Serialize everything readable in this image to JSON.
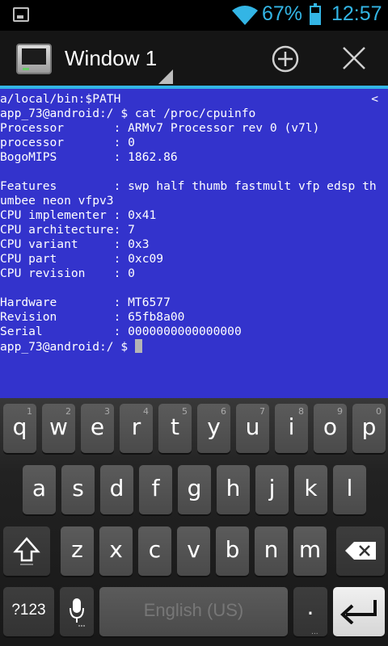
{
  "status_bar": {
    "battery_percent": "67%",
    "battery_level": 0.67,
    "time": "12:57",
    "accent_color": "#33b5e5"
  },
  "action_bar": {
    "title": "Window 1",
    "add_icon": "plus-circle-icon",
    "close_icon": "close-icon"
  },
  "terminal": {
    "background": "#3333cc",
    "overflow_marker": "<",
    "lines": [
      "a/local/bin:$PATH",
      "app_73@android:/ $ cat /proc/cpuinfo",
      "Processor       : ARMv7 Processor rev 0 (v7l)",
      "processor       : 0",
      "BogoMIPS        : 1862.86",
      "",
      "Features        : swp half thumb fastmult vfp edsp th",
      "umbee neon vfpv3",
      "CPU implementer : 0x41",
      "CPU architecture: 7",
      "CPU variant     : 0x3",
      "CPU part        : 0xc09",
      "CPU revision    : 0",
      "",
      "Hardware        : MT6577",
      "Revision        : 65fb8a00",
      "Serial          : 0000000000000000",
      "app_73@android:/ $ "
    ]
  },
  "keyboard": {
    "row1": [
      {
        "label": "q",
        "hint": "1"
      },
      {
        "label": "w",
        "hint": "2"
      },
      {
        "label": "e",
        "hint": "3"
      },
      {
        "label": "r",
        "hint": "4"
      },
      {
        "label": "t",
        "hint": "5"
      },
      {
        "label": "y",
        "hint": "6"
      },
      {
        "label": "u",
        "hint": "7"
      },
      {
        "label": "i",
        "hint": "8"
      },
      {
        "label": "o",
        "hint": "9"
      },
      {
        "label": "p",
        "hint": "0"
      }
    ],
    "row2": [
      "a",
      "s",
      "d",
      "f",
      "g",
      "h",
      "j",
      "k",
      "l"
    ],
    "row3": [
      "z",
      "x",
      "c",
      "v",
      "b",
      "n",
      "m"
    ],
    "symbols_label": "?123",
    "space_label": "English (US)",
    "period_label": ".",
    "shift_icon": "shift-icon",
    "backspace_icon": "backspace-icon",
    "mic_icon": "microphone-icon",
    "enter_icon": "enter-icon"
  }
}
